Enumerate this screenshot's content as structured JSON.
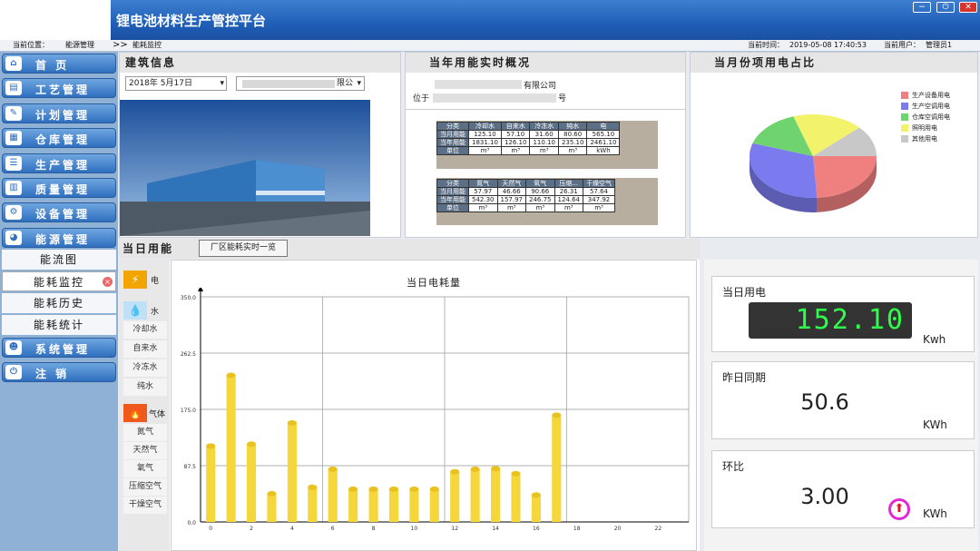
{
  "header": {
    "title": "锂电池材料生产管控平台"
  },
  "breadcrumb": {
    "label": "当前位置：",
    "path1": "能源管理",
    "sep": ">>",
    "path2": "能耗监控"
  },
  "status": {
    "time_label": "当前时间：",
    "time": "2019-05-08 17:40:53",
    "user_label": "当前用户：",
    "user": "管理员1"
  },
  "nav": [
    {
      "label": "首 页",
      "icon": "home-icon",
      "glyph": "⌂"
    },
    {
      "label": "工艺管理",
      "icon": "document-icon",
      "glyph": "▤"
    },
    {
      "label": "计划管理",
      "icon": "document-edit-icon",
      "glyph": "✎"
    },
    {
      "label": "仓库管理",
      "icon": "warehouse-icon",
      "glyph": "▦"
    },
    {
      "label": "生产管理",
      "icon": "list-icon",
      "glyph": "☰"
    },
    {
      "label": "质量管理",
      "icon": "chart-icon",
      "glyph": "▥"
    },
    {
      "label": "设备管理",
      "icon": "gear-icon",
      "glyph": "⚙"
    },
    {
      "label": "能源管理",
      "icon": "energy-icon",
      "glyph": "◕"
    }
  ],
  "sub_nav": [
    "能流图",
    "能耗监控",
    "能耗历史",
    "能耗统计"
  ],
  "nav_bottom": [
    {
      "label": "系统管理",
      "icon": "system-icon",
      "glyph": "☻"
    },
    {
      "label": "注 销",
      "icon": "power-icon",
      "glyph": "⏻"
    }
  ],
  "building": {
    "title": "建筑信息",
    "date": "2018年 5月17日",
    "company_suffix": "限公"
  },
  "year": {
    "title": "当年用能实时概况",
    "company": "有限公司",
    "address_label": "位于",
    "address_suffix": "号",
    "table1": {
      "headers": [
        "分类",
        "冷却水",
        "自来水",
        "冷冻水",
        "纯水",
        "电"
      ],
      "rows": [
        [
          "当月用能",
          "125.10",
          "57.10",
          "31.60",
          "80.60",
          "565.10"
        ],
        [
          "当年用能",
          "1831.10",
          "126.10",
          "110.10",
          "235.10",
          "2461.10"
        ],
        [
          "单位",
          "m³",
          "m³",
          "m³",
          "m³",
          "kWh"
        ]
      ]
    },
    "table2": {
      "headers": [
        "分类",
        "氮气",
        "天然气",
        "氧气",
        "压缩...",
        "干燥空气"
      ],
      "rows": [
        [
          "当月用能",
          "57.97",
          "46.66",
          "90.66",
          "26.31",
          "57.64"
        ],
        [
          "当年用能",
          "542.30",
          "157.97",
          "246.75",
          "124.64",
          "347.92"
        ],
        [
          "单位",
          "m³",
          "m³",
          "m³",
          "m³",
          "m³"
        ]
      ]
    }
  },
  "month": {
    "title": "当月份项用电占比",
    "legend": [
      {
        "label": "生产设备用电",
        "color": "#f08080"
      },
      {
        "label": "生产空调用电",
        "color": "#7b7bef"
      },
      {
        "label": "仓库空调用电",
        "color": "#6fd36f"
      },
      {
        "label": "照明用电",
        "color": "#f2f26b"
      },
      {
        "label": "其他用电",
        "color": "#c8c8c8"
      }
    ],
    "pie_values": [
      0.24,
      0.31,
      0.15,
      0.18,
      0.12
    ]
  },
  "daily": {
    "title": "当日用能",
    "overview_button": "厂区能耗实时一览"
  },
  "types": {
    "elec": "电",
    "water": "水",
    "water_items": [
      "冷却水",
      "自来水",
      "冷冻水",
      "纯水"
    ],
    "gas": "气体",
    "gas_items": [
      "氮气",
      "天然气",
      "氧气",
      "压缩空气",
      "干燥空气"
    ]
  },
  "chart_data": {
    "type": "bar",
    "title": "当日电耗量",
    "x": [
      0,
      1,
      2,
      3,
      4,
      5,
      6,
      7,
      8,
      9,
      10,
      11,
      12,
      13,
      14,
      15,
      16
    ],
    "values": [
      118,
      228,
      121,
      44,
      154,
      54,
      82,
      51,
      51,
      51,
      51,
      51,
      78,
      82,
      83,
      75,
      42,
      166
    ],
    "xticks": [
      "0",
      "2",
      "4",
      "6",
      "8",
      "10",
      "12",
      "14",
      "16",
      "18",
      "20",
      "22"
    ],
    "yticks": [
      "0.0",
      "87.5",
      "175.0",
      "262.5",
      "350.0"
    ],
    "ylim": [
      0,
      350
    ],
    "xlim": [
      -0.5,
      23.5
    ],
    "bar_color": "#f5d63b"
  },
  "stats": {
    "today": {
      "label": "当日用电",
      "value": "152.10",
      "unit": "Kwh"
    },
    "yesterday": {
      "label": "昨日同期",
      "value": "50.6",
      "unit": "KWh"
    },
    "ratio": {
      "label": "环比",
      "value": "3.00",
      "unit": "KWh"
    }
  },
  "colors": {
    "header": "#1f5fb8",
    "led": "#2eff4a"
  }
}
